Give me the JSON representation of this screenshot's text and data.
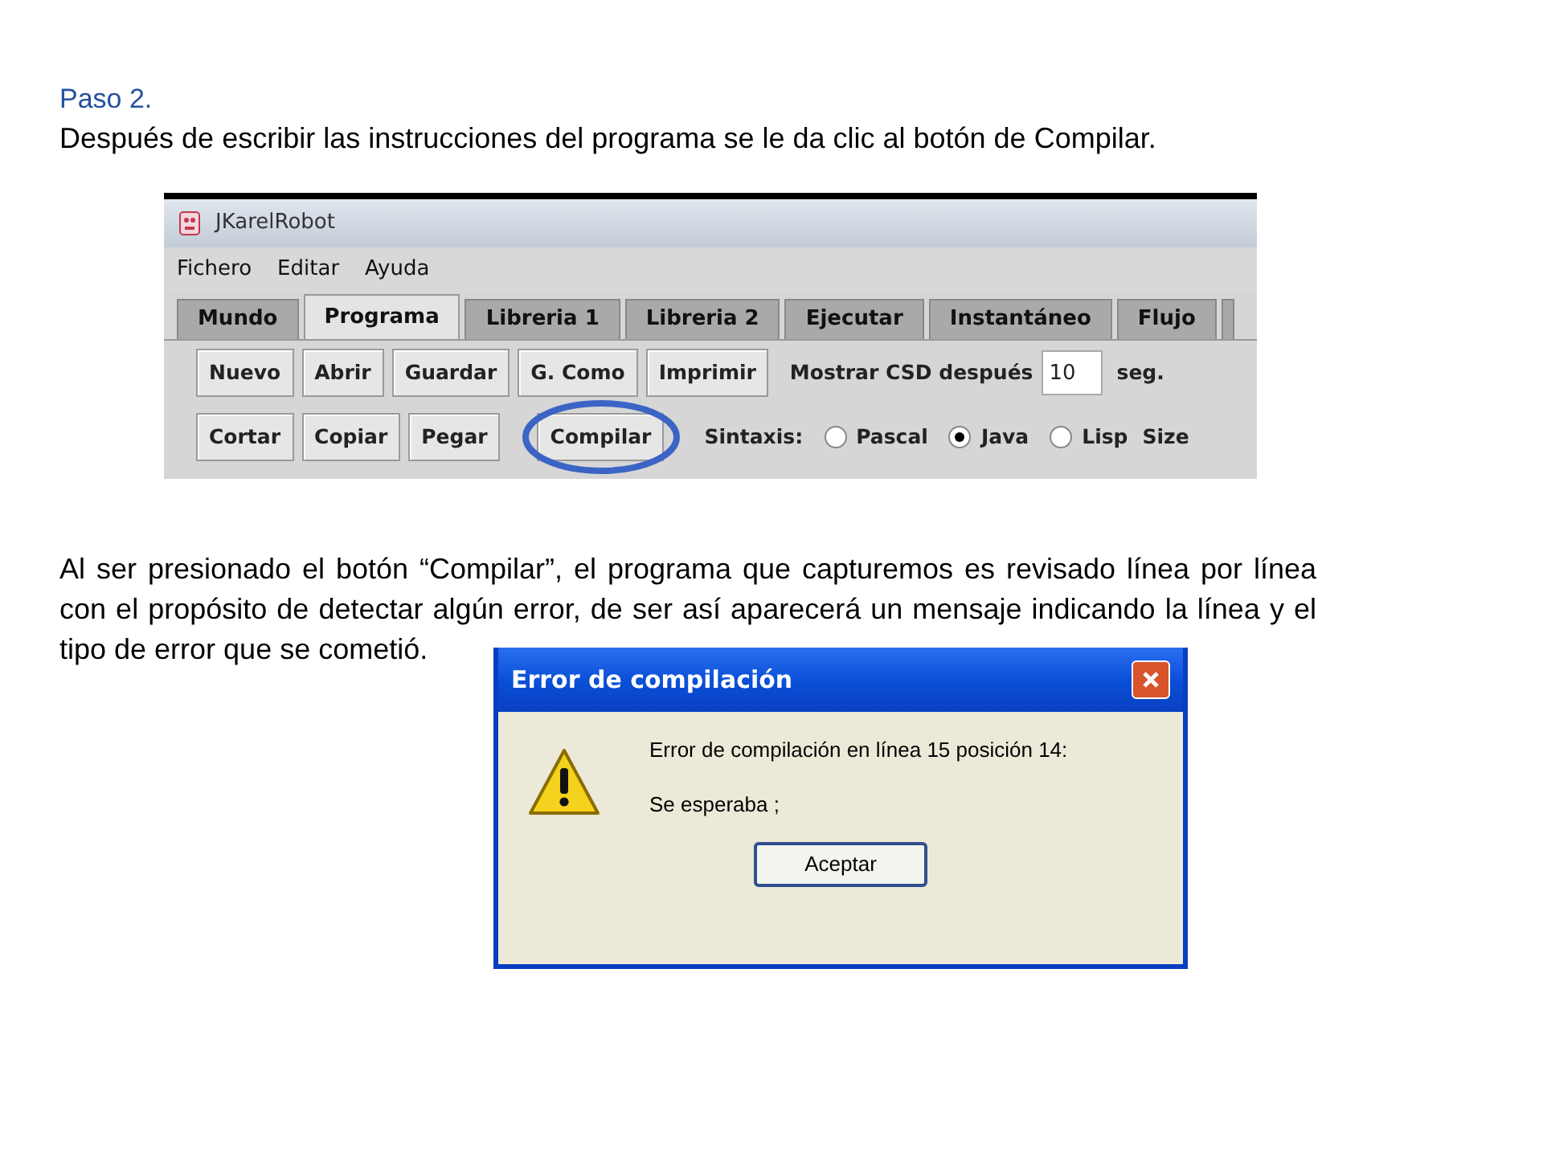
{
  "heading": "Paso 2.",
  "intro": "Después de escribir las instrucciones del programa se le da clic al botón de Compilar.",
  "app_window": {
    "title": "JKarelRobot",
    "menu": [
      "Fichero",
      "Editar",
      "Ayuda"
    ],
    "tabs": [
      {
        "label": "Mundo",
        "selected": false
      },
      {
        "label": "Programa",
        "selected": true
      },
      {
        "label": "Libreria 1",
        "selected": false
      },
      {
        "label": "Libreria 2",
        "selected": false
      },
      {
        "label": "Ejecutar",
        "selected": false
      },
      {
        "label": "Instantáneo",
        "selected": false
      },
      {
        "label": "Flujo",
        "selected": false
      }
    ],
    "toolbar_row_1": {
      "buttons": [
        "Nuevo",
        "Abrir",
        "Guardar",
        "G. Como",
        "Imprimir"
      ],
      "delay_label": "Mostrar CSD después",
      "delay_value": "10",
      "delay_unit": "seg."
    },
    "toolbar_row_2": {
      "buttons": [
        {
          "label": "Cortar",
          "circled": false
        },
        {
          "label": "Copiar",
          "circled": false
        },
        {
          "label": "Pegar",
          "circled": false
        },
        {
          "label": "Compilar",
          "circled": true
        }
      ],
      "syntax_label": "Sintaxis:",
      "syntax_options": [
        {
          "label": "Pascal",
          "selected": false
        },
        {
          "label": "Java",
          "selected": true
        },
        {
          "label": "Lisp",
          "selected": false
        }
      ],
      "trailing_label": "Size"
    }
  },
  "description": "Al ser presionado el botón “Compilar”, el programa que capturemos es revisado línea por línea con el propósito de detectar algún error, de ser así aparecerá un mensaje indicando la línea y el tipo de error que se cometió.",
  "dialog": {
    "title": "Error de compilación",
    "message": "Error de compilación en línea 15 posición 14:",
    "detail": "Se esperaba ;",
    "ok_button": "Aceptar"
  }
}
